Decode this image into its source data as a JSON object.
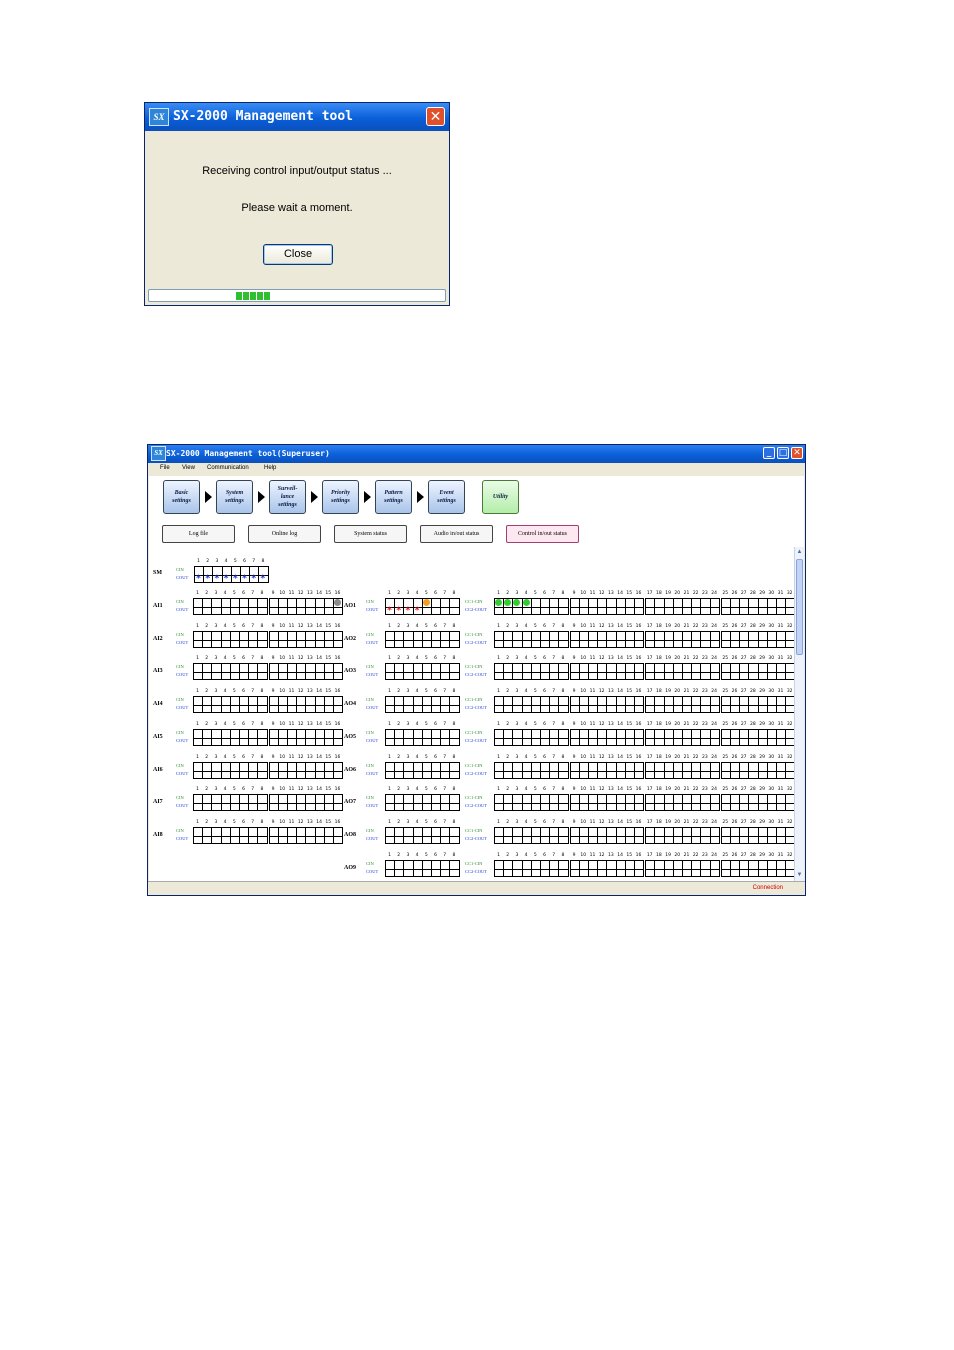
{
  "dialog": {
    "title": "SX-2000 Management tool",
    "app_icon": "SX",
    "message1": "Receiving control input/output status ...",
    "message2": "Please wait a moment.",
    "close_label": "Close",
    "close_icon": "close-icon",
    "progress_color": "#2fbf2f"
  },
  "window": {
    "title": "SX-2000 Management tool(Superuser)",
    "app_icon": "SX",
    "menu": [
      "File",
      "View",
      "Communication",
      "Help"
    ],
    "steps": [
      "Basic settings",
      "System settings",
      "Surveil- lance settings",
      "Priority settings",
      "Pattern settings",
      "Event settings",
      "Utility"
    ],
    "tabs": [
      "Log file",
      "Online log",
      "System status",
      "Audio in/out status",
      "Control in/out status"
    ],
    "selected_tab": "Control in/out status",
    "status": "Connection"
  },
  "status_panel": {
    "cin_label": "CIN",
    "cout_label": "COUT",
    "cci_cin_label": "CC1-CIN",
    "cc2_cout_label": "CC2-COUT",
    "sm": {
      "label": "SM",
      "numbers": [
        "1",
        "2",
        "3",
        "4",
        "5",
        "6",
        "7",
        "8"
      ],
      "cout_stars": [
        1,
        2,
        3,
        4,
        5,
        6,
        7,
        8
      ],
      "star_color": "#1a3ad0"
    },
    "ai_numbers": [
      "1",
      "2",
      "3",
      "4",
      "5",
      "6",
      "7",
      "8",
      "9",
      "10",
      "11",
      "12",
      "13",
      "14",
      "15",
      "16"
    ],
    "ao_numbers": [
      "1",
      "2",
      "3",
      "4",
      "5",
      "6",
      "7",
      "8"
    ],
    "cc_numbers": [
      "1",
      "2",
      "3",
      "4",
      "5",
      "6",
      "7",
      "8",
      "9",
      "10",
      "11",
      "12",
      "13",
      "14",
      "15",
      "16",
      "17",
      "18",
      "19",
      "20",
      "21",
      "22",
      "23",
      "24",
      "25",
      "26",
      "27",
      "28",
      "29",
      "30",
      "31",
      "32"
    ],
    "ai_labels": [
      "AI1",
      "AI2",
      "AI3",
      "AI4",
      "AI5",
      "AI6",
      "AI7",
      "AI8"
    ],
    "ao_labels": [
      "AO1",
      "AO2",
      "AO3",
      "AO4",
      "AO5",
      "AO6",
      "AO7",
      "AO8",
      "AO9"
    ],
    "ai1_cin_dot": {
      "index": 16,
      "color": "#8a8a8a"
    },
    "ao1_cin_dot": {
      "index": 5,
      "color": "#f0a020"
    },
    "ao1_cout_stars": [
      1,
      2,
      3,
      4
    ],
    "ao1_star_color": "#e02020",
    "cc1_cin_dots": [
      1,
      2,
      3,
      4
    ],
    "cc1_dot_color": "#33cc33"
  }
}
